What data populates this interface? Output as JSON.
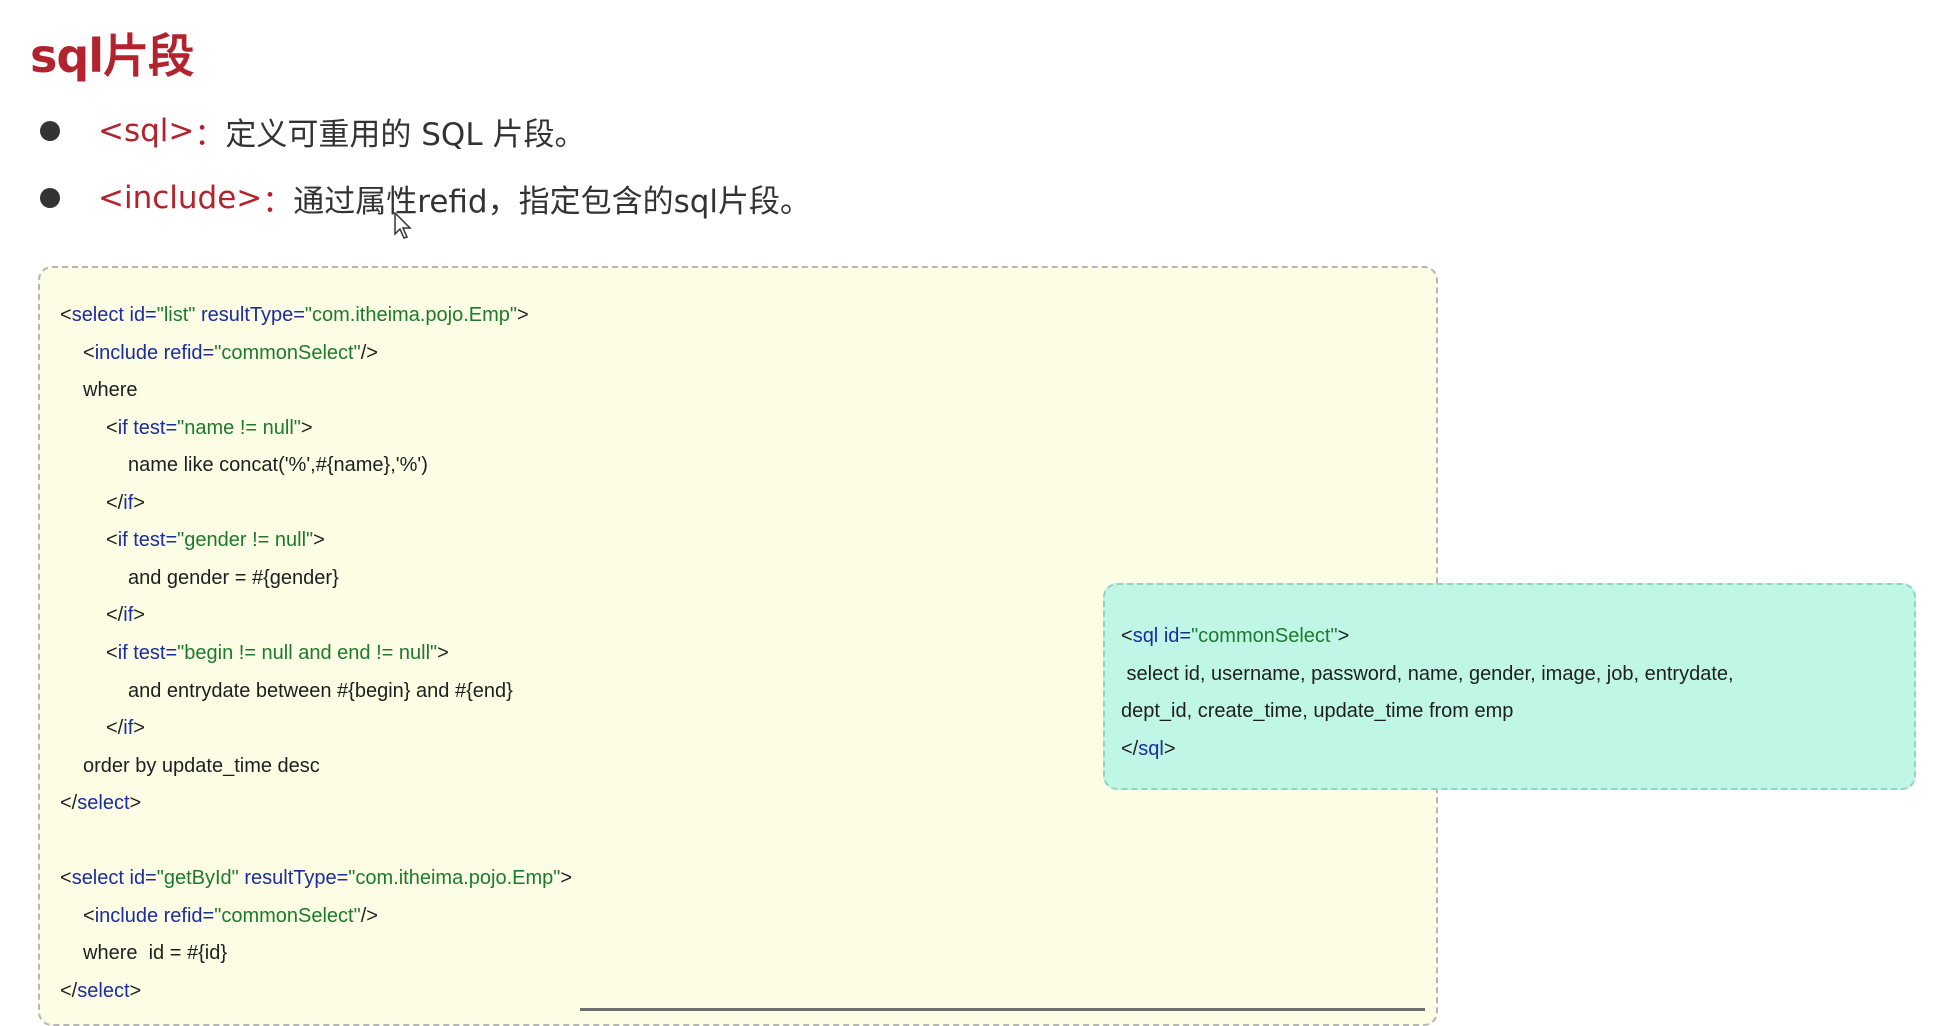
{
  "title": "sql片段",
  "bullets": [
    {
      "tag": "<sql>",
      "sep": "：",
      "text": "定义可重用的 SQL 片段。"
    },
    {
      "tag": "<include>",
      "sep": "：",
      "text": "通过属性refid，指定包含的sql片段。"
    }
  ],
  "code_main": {
    "l1": {
      "a": "<",
      "b": "select",
      "c": " id=",
      "d": "\"list\"",
      "e": " resultType=",
      "f": "\"com.itheima.pojo.Emp\"",
      "g": ">"
    },
    "l2": {
      "a": "<",
      "b": "include",
      "c": " refid=",
      "d": "\"commonSelect\"",
      "e": "/>"
    },
    "l3": "where",
    "l4": {
      "a": "<",
      "b": "if",
      "c": " test=",
      "d": "\"name != null\"",
      "e": ">"
    },
    "l5": "name like concat('%',#{name},'%')",
    "l6": {
      "a": "</",
      "b": "if",
      "c": ">"
    },
    "l7": {
      "a": "<",
      "b": "if",
      "c": " test=",
      "d": "\"gender != null\"",
      "e": ">"
    },
    "l8": "and gender = #{gender}",
    "l9": {
      "a": "</",
      "b": "if",
      "c": ">"
    },
    "l10": {
      "a": "<",
      "b": "if",
      "c": " test=",
      "d": "\"begin != null and end != null\"",
      "e": ">"
    },
    "l11": "and entrydate between #{begin} and #{end}",
    "l12": {
      "a": "</",
      "b": "if",
      "c": ">"
    },
    "l13": "order by update_time desc",
    "l14": {
      "a": "</",
      "b": "select",
      "c": ">"
    },
    "l15": {
      "a": "<",
      "b": "select",
      "c": " id=",
      "d": "\"getById\"",
      "e": " resultType=",
      "f": "\"com.itheima.pojo.Emp\"",
      "g": ">"
    },
    "l16": {
      "a": "<",
      "b": "include",
      "c": " refid=",
      "d": "\"commonSelect\"",
      "e": "/>"
    },
    "l17": "where  id = #{id}",
    "l18": {
      "a": "</",
      "b": "select",
      "c": ">"
    }
  },
  "code_sql": {
    "l1": {
      "a": "<",
      "b": "sql",
      "c": " id=",
      "d": "\"commonSelect\"",
      "e": ">"
    },
    "l2": " select id, username, password, name, gender, image, job, entrydate,",
    "l3": "dept_id, create_time, update_time from emp",
    "l4": {
      "a": "</",
      "b": "sql",
      "c": ">"
    }
  }
}
